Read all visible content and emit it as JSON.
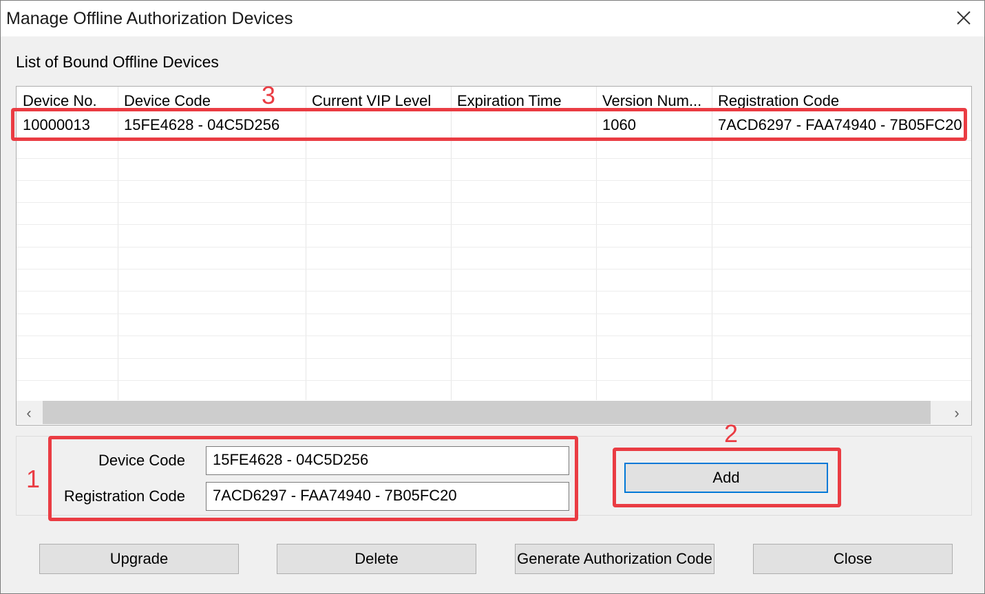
{
  "window": {
    "title": "Manage Offline Authorization Devices"
  },
  "list": {
    "label": "List of Bound Offline Devices",
    "columns": [
      "Device No.",
      "Device Code",
      "Current VIP Level",
      "Expiration Time",
      "Version Num...",
      "Registration Code"
    ],
    "rows": [
      [
        "10000013",
        "15FE4628 - 04C5D256",
        "",
        "",
        "1060",
        "7ACD6297 - FAA74940 - 7B05FC20"
      ]
    ]
  },
  "form": {
    "device_code_label": "Device Code",
    "device_code_value": "15FE4628 - 04C5D256",
    "registration_code_label": "Registration Code",
    "registration_code_value": "7ACD6297 - FAA74940 - 7B05FC20",
    "add_label": "Add"
  },
  "buttons": {
    "upgrade": "Upgrade",
    "delete": "Delete",
    "generate": "Generate Authorization Code",
    "close": "Close"
  },
  "annotations": {
    "one": "1",
    "two": "2",
    "three": "3",
    "color": "#ea3c43"
  },
  "icons": {
    "close": "close-icon",
    "scroll_left": "chevron-left-icon",
    "scroll_right": "chevron-right-icon"
  }
}
